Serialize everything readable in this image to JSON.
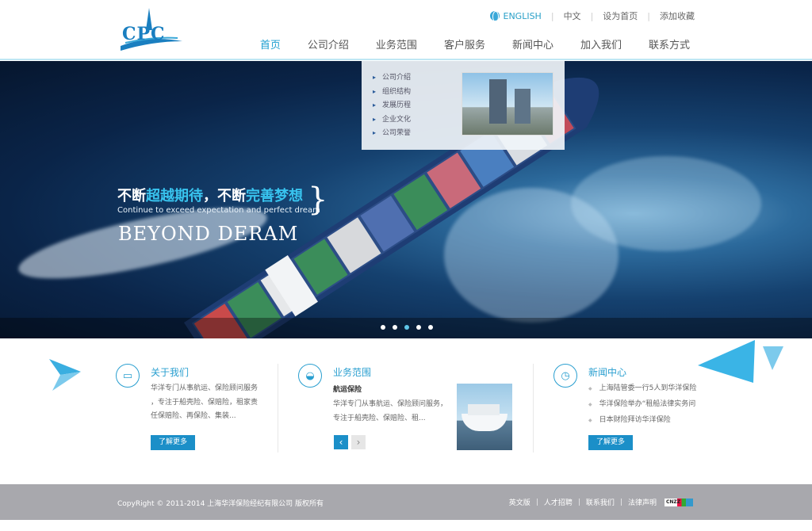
{
  "header": {
    "logo_text": "CPC",
    "toplinks": {
      "english": "ENGLISH",
      "chinese": "中文",
      "set_home": "设为首页",
      "add_favorite": "添加收藏"
    },
    "nav": [
      "首页",
      "公司介绍",
      "业务范围",
      "客户服务",
      "新闻中心",
      "加入我们",
      "联系方式"
    ],
    "nav_active_index": 0
  },
  "dropdown": {
    "items": [
      "公司介绍",
      "组织结构",
      "发展历程",
      "企业文化",
      "公司荣誉"
    ]
  },
  "hero": {
    "cn_part1": "不断",
    "cn_hl1": "超越期待",
    "cn_part2": "，不断",
    "cn_hl2": "完善梦想",
    "en_sub": "Continue to exceed expectation and perfect dream",
    "en_big": "BEYOND DERAM",
    "slides": 5,
    "active_slide": 3
  },
  "about": {
    "title": "关于我们",
    "text_lines": [
      "华洋专门从事航运、保险顾问服务",
      "，专注于船壳险、保赔险，租家责",
      "任保赔险、再保险、集装..."
    ],
    "more": "了解更多",
    "icon": "monitor-icon"
  },
  "business": {
    "title": "业务范围",
    "subtitle": "航运保险",
    "text_lines": [
      "华洋专门从事航运、保险顾问服务，",
      "专注于船壳险、保赔险、租..."
    ],
    "prev": "‹",
    "next": "›",
    "icon": "ship-icon"
  },
  "news": {
    "title": "新闻中心",
    "items": [
      "上海陆管委一行5人到华洋保险",
      "华洋保险举办“租船法律实务问",
      "日本财险拜访华洋保险"
    ],
    "more": "了解更多",
    "icon": "clock-icon"
  },
  "footer": {
    "copyright": "CopyRight © 2011-2014 上海华洋保险经纪有限公司  版权所有",
    "links": [
      "英文版",
      "人才招聘",
      "联系我们",
      "法律声明"
    ],
    "badge": "CNZZ"
  },
  "colors": {
    "accent": "#1d9ed0",
    "button": "#1b8fc8",
    "footer": "#a8a8ad"
  }
}
